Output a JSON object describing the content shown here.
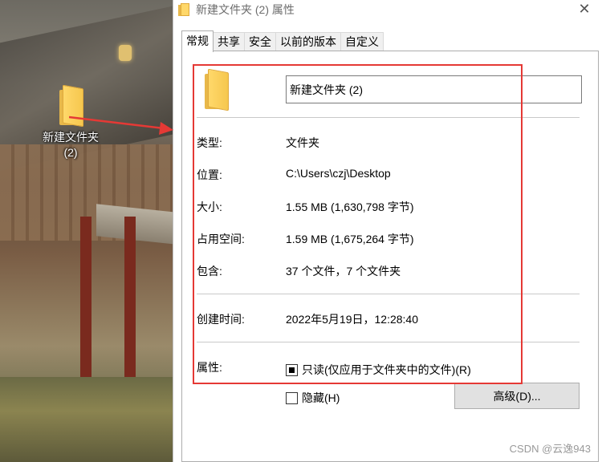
{
  "desktop": {
    "icon_label_line1": "新建文件夹",
    "icon_label_line2": "(2)"
  },
  "window": {
    "title": "新建文件夹 (2) 属性",
    "close_glyph": "✕"
  },
  "tabs": [
    {
      "label": "常规",
      "active": true
    },
    {
      "label": "共享",
      "active": false
    },
    {
      "label": "安全",
      "active": false
    },
    {
      "label": "以前的版本",
      "active": false
    },
    {
      "label": "自定义",
      "active": false
    }
  ],
  "general": {
    "name_value": "新建文件夹 (2)",
    "type_label": "类型:",
    "type_value": "文件夹",
    "location_label": "位置:",
    "location_value": "C:\\Users\\czj\\Desktop",
    "size_label": "大小:",
    "size_value": "1.55 MB (1,630,798 字节)",
    "size_on_disk_label": "占用空间:",
    "size_on_disk_value": "1.59 MB (1,675,264 字节)",
    "contains_label": "包含:",
    "contains_value": "37 个文件，7 个文件夹",
    "created_label": "创建时间:",
    "created_value": "2022年5月19日，12:28:40",
    "attributes_label": "属性:",
    "readonly_label": "只读(仅应用于文件夹中的文件)(R)",
    "readonly_state": "indeterminate",
    "hidden_label": "隐藏(H)",
    "hidden_checked": false,
    "advanced_button": "高级(D)..."
  },
  "annotation": {
    "color": "#e53935"
  },
  "watermark": "CSDN @云逸943",
  "icons": {
    "folder": "folder-icon",
    "close": "close-icon",
    "arrow": "red-arrow-icon"
  }
}
